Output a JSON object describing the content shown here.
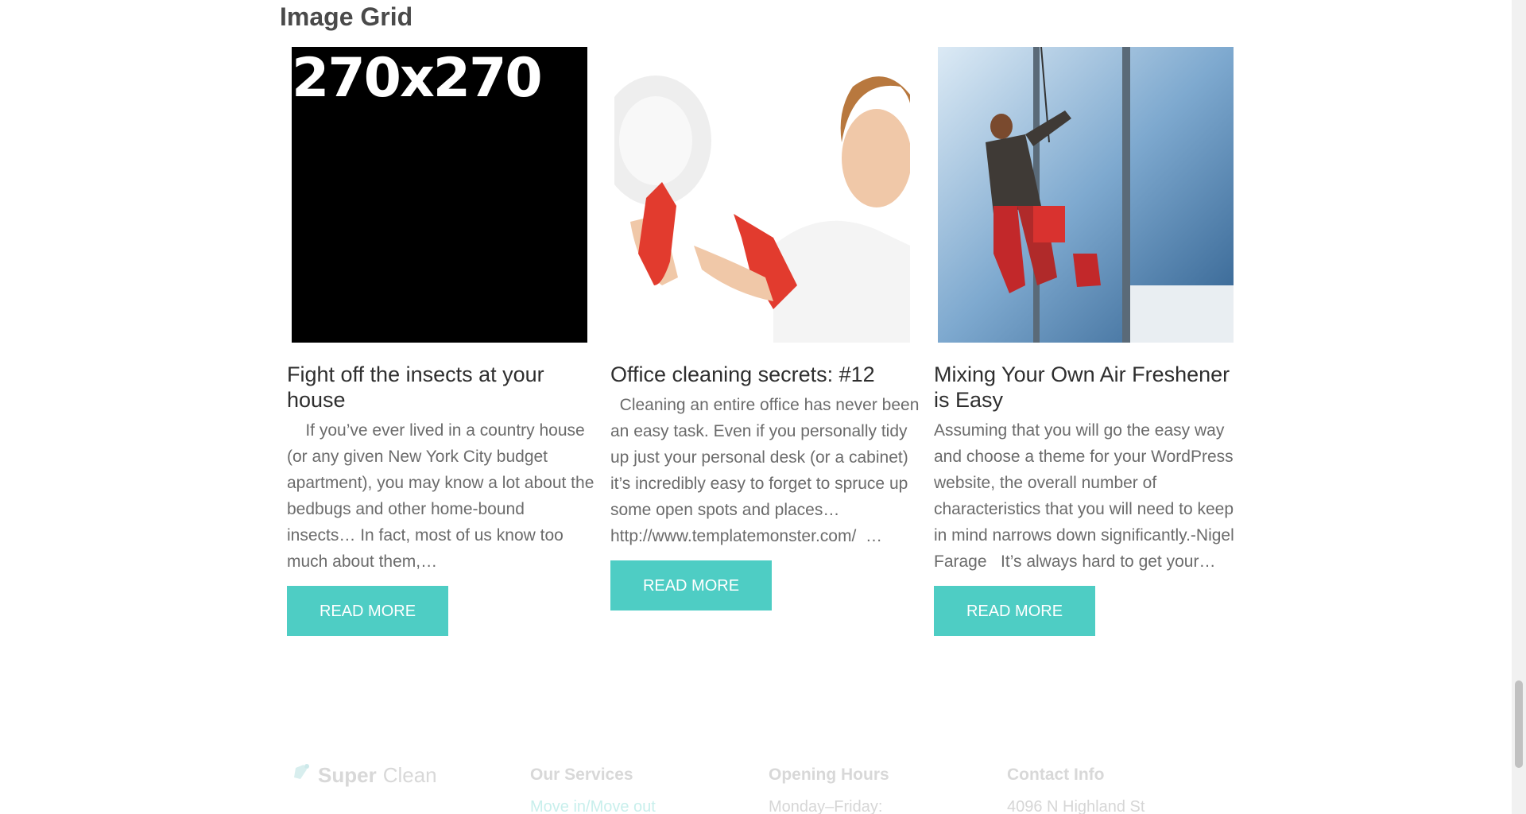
{
  "section": {
    "title": "Image Grid"
  },
  "cards": [
    {
      "placeholder": "270x270",
      "title": "Fight off the insects at your house",
      "excerpt": "    If you’ve ever lived in a country house (or any given New York City budget apartment), you may know a lot about the bedbugs and other home-bound insects… In fact, most of us know too much about them,…",
      "button": "READ MORE"
    },
    {
      "title": "Office cleaning secrets: #12",
      "excerpt": "  Cleaning an entire office has never been an easy task. Even if you personally tidy up just your personal desk (or a cabinet) it’s incredibly easy to forget to spruce up some open spots and places… http://www.templatemonster.com/  …",
      "button": "READ MORE"
    },
    {
      "title": "Mixing Your Own Air Freshener is Easy",
      "excerpt": "Assuming that you will go the easy way and choose a theme for your WordPress website, the overall number of characteristics that you will need to keep in mind narrows down significantly.-Nigel Farage   It’s always hard to get your…",
      "button": "READ MORE"
    }
  ],
  "footer": {
    "logo_bold": "Super",
    "logo_light": "Clean",
    "services_heading": "Our Services",
    "services_first_link": "Move in/Move out",
    "hours_heading": "Opening Hours",
    "hours_first_line": "Monday–Friday:",
    "contact_heading": "Contact Info",
    "contact_first_line": "4096 N Highland St"
  },
  "colors": {
    "accent": "#4ecdc4",
    "footer_link": "#c8efec"
  }
}
